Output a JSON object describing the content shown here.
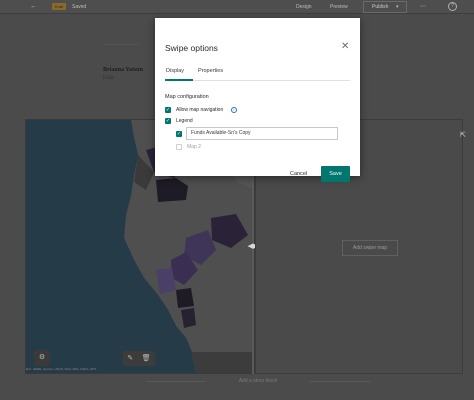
{
  "topbar": {
    "back_icon": "arrow-left-icon",
    "status_badge": "Draft",
    "saved_text": "Saved",
    "design_label": "Design",
    "preview_label": "Preview",
    "publish_label": "Publish",
    "more_icon": "more-dots-icon",
    "help_icon": "help-icon"
  },
  "story": {
    "author": "Brianna Yatsun",
    "status": "Draft"
  },
  "canvas": {
    "add_map_label": "Add swipe map",
    "add_block_label": "Add a story block"
  },
  "map": {
    "attribution": "Esri, HERE, Garmin, USGS, NGA, EPA, USDA, NPS"
  },
  "modal": {
    "title": "Swipe options",
    "tabs": [
      {
        "label": "Display",
        "active": true
      },
      {
        "label": "Properties",
        "active": false
      }
    ],
    "section_label": "Map configuration",
    "options": {
      "allow_nav_label": "Allow map navigation",
      "allow_nav_checked": true,
      "legend_label": "Legend",
      "legend_checked": true,
      "map1_layer_value": "Funds Available-Sn's Copy",
      "map1_checked": true,
      "map2_label": "Map 2",
      "map2_checked": false
    },
    "cancel_label": "Cancel",
    "save_label": "Save"
  },
  "colors": {
    "accent": "#00766f",
    "overlay_bg": "#4a4a4a",
    "water": "#253b47",
    "land": "#4d4d4d"
  }
}
